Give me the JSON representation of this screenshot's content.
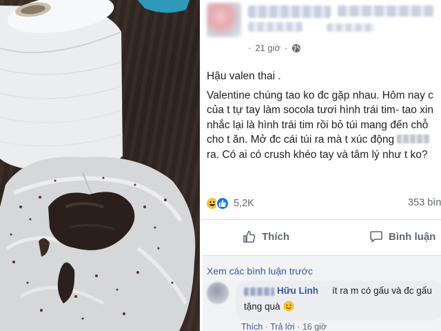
{
  "post": {
    "time": "21 giờ",
    "separator": "·",
    "body": {
      "line1": "Hậu valen thai .",
      "line2": "Valentine chúng tao ko đc gặp nhau. Hôm nay c",
      "line3": "của t tự tay làm socola tươi hình trái tim- tao xin",
      "line4": "nhắc lại là hình trái tim rồi bỏ túi mang đến chỗ",
      "line5": "cho t ăn. Mở đc cái túi ra mà t xúc động",
      "line6": "ra. Có ai có crush khéo tay và tâm lý như t ko?"
    },
    "reactions": {
      "count": "5,2K",
      "comments": "353 bìn"
    },
    "actions": {
      "like_label": "Thích",
      "comment_label": "Bình luận"
    }
  },
  "comments": {
    "view_previous": "Xem các bình luận trước",
    "items": [
      {
        "name": "Hữu Linh",
        "text_line1": "ít ra m có gấu và đc gấu",
        "text_line2": "tặng quà",
        "like": "Thích",
        "reply": "Trả lời",
        "time": "16 giờ",
        "separator": "·"
      }
    ]
  },
  "colors": {
    "link": "#385898",
    "like_blue": "#1877f2",
    "haha_yellow": "#f7c42c",
    "muted": "#606770",
    "comment_bg": "#ebedf0"
  }
}
